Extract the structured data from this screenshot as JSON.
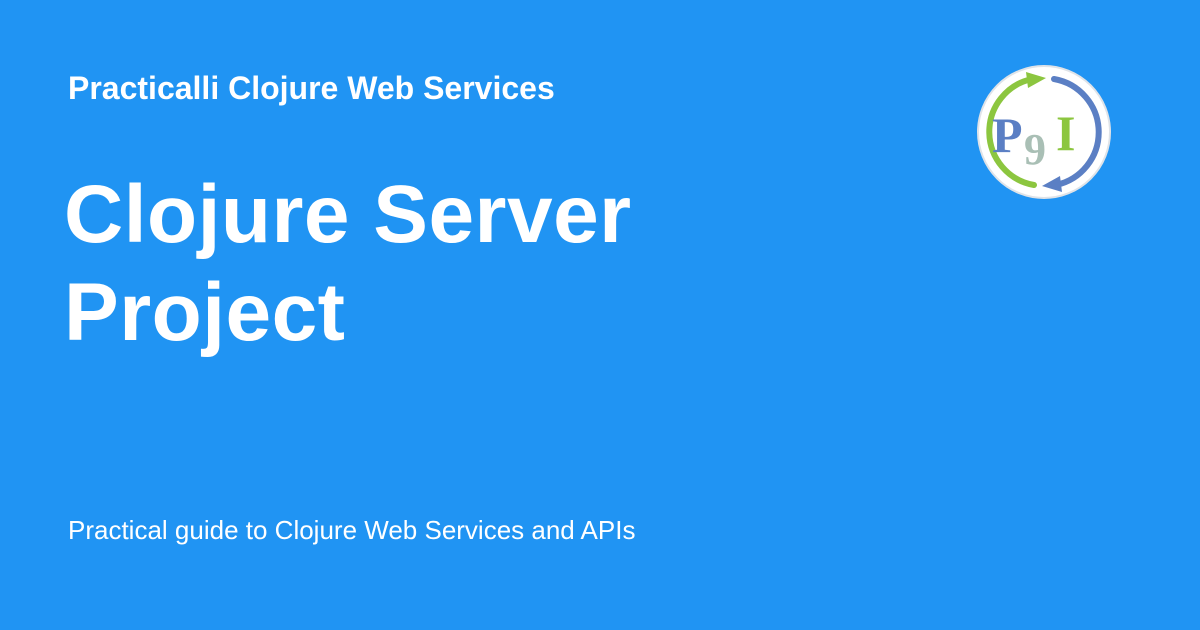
{
  "site": {
    "name": "Practicalli Clojure Web Services"
  },
  "page": {
    "title": "Clojure Server Project",
    "description": "Practical guide to Clojure Web Services and APIs"
  },
  "logo": {
    "icon": "practicalli-logo-icon",
    "letters": [
      "P",
      "9",
      "I"
    ]
  },
  "colors": {
    "background": "#2094f3",
    "text": "#ffffff",
    "logo_blue": "#5b7fc4",
    "logo_green": "#8cc63f",
    "logo_grey": "#a9bfb5"
  }
}
